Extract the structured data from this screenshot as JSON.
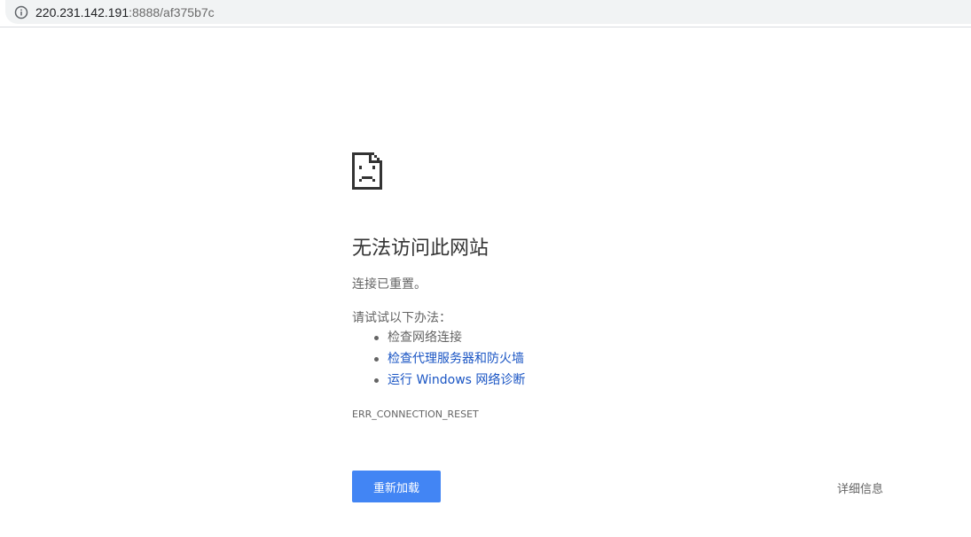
{
  "address_bar": {
    "host": "220.231.142.191",
    "rest": ":8888/af375b7c"
  },
  "icons": {
    "site_info": "info-icon",
    "error_page": "sad-page-icon"
  },
  "error": {
    "title": "无法访问此网站",
    "subtitle": "连接已重置。",
    "try_label": "请试试以下办法：",
    "suggestions": [
      {
        "text": "检查网络连接",
        "is_link": false
      },
      {
        "text": "检查代理服务器和防火墙",
        "is_link": true
      },
      {
        "text": "运行 Windows 网络诊断",
        "is_link": true
      }
    ],
    "code": "ERR_CONNECTION_RESET"
  },
  "buttons": {
    "reload": "重新加载",
    "details": "详细信息"
  },
  "colors": {
    "button_blue": "#4285f4",
    "link_blue": "#1a55c4",
    "text_gray": "#646464",
    "title_dark": "#333333"
  }
}
